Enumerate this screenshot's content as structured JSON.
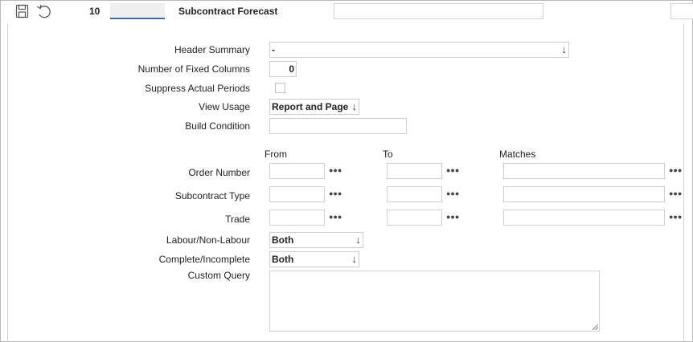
{
  "toolbar": {
    "number": "10",
    "title": "Subcontract Forecast",
    "search_value": ""
  },
  "form": {
    "header_summary": {
      "label": "Header Summary",
      "value": "-"
    },
    "fixed_columns": {
      "label": "Number of Fixed Columns",
      "value": "0"
    },
    "suppress_actual": {
      "label": "Suppress Actual Periods"
    },
    "view_usage": {
      "label": "View Usage",
      "value": "Report and Page"
    },
    "build_condition": {
      "label": "Build Condition",
      "value": ""
    },
    "columns": {
      "from": "From",
      "to": "To",
      "matches": "Matches"
    },
    "order_number": {
      "label": "Order Number"
    },
    "subcontract_type": {
      "label": "Subcontract Type"
    },
    "trade": {
      "label": "Trade"
    },
    "labour": {
      "label": "Labour/Non-Labour",
      "value": "Both"
    },
    "complete": {
      "label": "Complete/Incomplete",
      "value": "Both"
    },
    "custom_query": {
      "label": "Custom Query",
      "value": ""
    }
  },
  "icons": {
    "save": "floppy-disk-icon",
    "undo": "undo-icon",
    "dropdown": "arrow-down-icon",
    "lookup": "ellipsis-icon"
  },
  "colors": {
    "accent": "#3a6ea5",
    "border": "#cfcfcf"
  }
}
